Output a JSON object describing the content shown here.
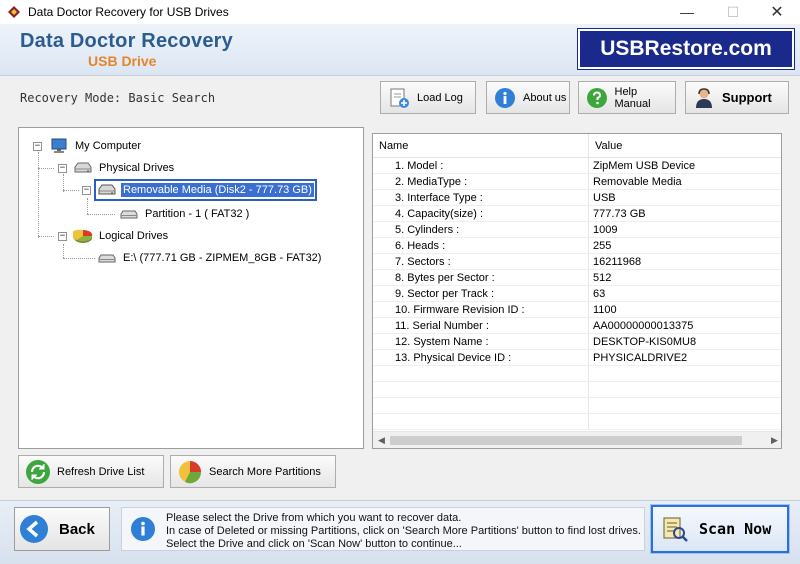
{
  "window": {
    "title": "Data Doctor Recovery for USB Drives",
    "minimize": "—",
    "maximize": "☐",
    "close": "✕"
  },
  "header": {
    "title_line1": "Data Doctor Recovery",
    "title_line2": "USB Drive",
    "brand": "USBRestore.com"
  },
  "toolbar": {
    "mode_text": "Recovery Mode: Basic Search",
    "load_log": "Load Log",
    "about_us": "About us",
    "help_manual": "Help Manual",
    "support": "Support"
  },
  "tree": {
    "root": "My Computer",
    "physical_drives": "Physical Drives",
    "removable_media": "Removable Media (Disk2 - 777.73 GB)",
    "partition": "Partition - 1 ( FAT32 )",
    "logical_drives": "Logical Drives",
    "logical_drive_e": "E:\\ (777.71 GB - ZIPMEM_8GB - FAT32)",
    "toggle_minus": "−"
  },
  "properties": {
    "header_name": "Name",
    "header_value": "Value",
    "rows": [
      {
        "name": "1. Model :",
        "value": "ZipMem USB Device"
      },
      {
        "name": "2. MediaType :",
        "value": "Removable Media"
      },
      {
        "name": "3. Interface Type :",
        "value": "USB"
      },
      {
        "name": "4. Capacity(size) :",
        "value": "777.73 GB"
      },
      {
        "name": "5. Cylinders :",
        "value": "1009"
      },
      {
        "name": "6. Heads :",
        "value": "255"
      },
      {
        "name": "7. Sectors :",
        "value": "16211968"
      },
      {
        "name": "8. Bytes per Sector :",
        "value": "512"
      },
      {
        "name": "9. Sector per Track :",
        "value": "63"
      },
      {
        "name": "10. Firmware Revision ID :",
        "value": "1100"
      },
      {
        "name": "11. Serial Number :",
        "value": "AA00000000013375"
      },
      {
        "name": "12. System Name :",
        "value": "DESKTOP-KIS0MU8"
      },
      {
        "name": "13. Physical Device ID :",
        "value": "PHYSICALDRIVE2"
      },
      {
        "name": "",
        "value": ""
      },
      {
        "name": "",
        "value": ""
      },
      {
        "name": "",
        "value": ""
      },
      {
        "name": "",
        "value": ""
      }
    ],
    "scroll_left": "◀",
    "scroll_right": "▶"
  },
  "actions": {
    "refresh": "Refresh Drive List",
    "search_more": "Search More Partitions"
  },
  "footer": {
    "back": "Back",
    "info_line1": "Please select the Drive from which you want to recover data.",
    "info_line2": "In case of Deleted or missing Partitions, click on 'Search More Partitions' button to find lost drives.",
    "info_line3": "Select the Drive and click on 'Scan Now' button to continue...",
    "scan_now": "Scan Now"
  },
  "colors": {
    "brand_bg": "#1a2a8c",
    "title_blue": "#2c5d92",
    "subtitle_orange": "#e3862a",
    "selection": "#3a6fd0"
  },
  "icons": {
    "app": "app-logo-icon",
    "load_log": "document-add-icon",
    "about": "info-icon",
    "help": "question-icon",
    "support": "support-person-icon",
    "computer": "computer-icon",
    "drive": "drive-icon",
    "pie": "pie-chart-icon",
    "refresh": "refresh-icon",
    "back": "back-arrow-icon",
    "scan": "scan-icon"
  }
}
